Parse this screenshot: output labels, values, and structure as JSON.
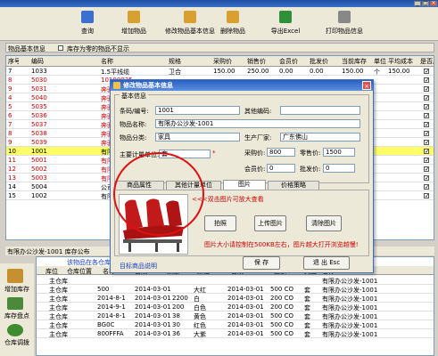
{
  "window": {
    "min": "_",
    "max": "□",
    "close": "×"
  },
  "toolbar": {
    "buttons": [
      {
        "label": "查询",
        "icon": "magnifier-icon",
        "color": "#3b6fd0"
      },
      {
        "label": "增加物品",
        "icon": "add-item-icon",
        "color": "#d8a030"
      },
      {
        "label": "修改物品基本信息",
        "icon": "edit-item-icon",
        "color": "#d8a030"
      },
      {
        "label": "删除物品",
        "icon": "delete-item-icon",
        "color": "#d8a030"
      },
      {
        "label": "导出Excel",
        "icon": "excel-icon",
        "color": "#2f8f3a"
      },
      {
        "label": "打印物品信息",
        "icon": "print-icon",
        "color": "#888888"
      }
    ]
  },
  "filter": {
    "section_label": "物品基本信息",
    "checkbox_label": "库存为零的物品不显示"
  },
  "grid": {
    "headers": [
      "序号",
      "编码",
      "名称",
      "规格",
      "采购价",
      "销售价",
      "会员价",
      "批发价",
      "当前库存",
      "单位",
      "平均成本",
      "是否启用"
    ],
    "rows": [
      {
        "no": "7",
        "code": "1033",
        "name": "1.5平线缆",
        "spec": "卫合",
        "buy": "150.00",
        "sell": "250.00",
        "member": "0.00",
        "whole": "0.00",
        "stock": "150.00",
        "unit": "个",
        "avg": "150.00",
        "red": false
      },
      {
        "no": "8",
        "code": "5030",
        "name": "10100035",
        "spec": "",
        "buy": "",
        "sell": "",
        "member": "",
        "whole": "",
        "stock": "",
        "unit": "",
        "avg": "",
        "red": true
      },
      {
        "no": "9",
        "code": "5031",
        "name": "奔驰F",
        "spec": "",
        "buy": "",
        "sell": "",
        "member": "",
        "whole": "",
        "stock": "",
        "unit": "",
        "avg": "",
        "red": true
      },
      {
        "no": "4",
        "code": "5040",
        "name": "奔驰F",
        "spec": "",
        "buy": "",
        "sell": "",
        "member": "",
        "whole": "",
        "stock": "",
        "unit": "",
        "avg": "",
        "red": true
      },
      {
        "no": "5",
        "code": "5035",
        "name": "奔驰不铁",
        "spec": "",
        "buy": "",
        "sell": "",
        "member": "",
        "whole": "",
        "stock": "",
        "unit": "",
        "avg": "",
        "red": true
      },
      {
        "no": "6",
        "code": "5036",
        "name": "奔驰B",
        "spec": "",
        "buy": "",
        "sell": "",
        "member": "",
        "whole": "",
        "stock": "",
        "unit": "",
        "avg": "",
        "red": true
      },
      {
        "no": "7",
        "code": "5037",
        "name": "奔驰C",
        "spec": "",
        "buy": "",
        "sell": "",
        "member": "",
        "whole": "",
        "stock": "",
        "unit": "",
        "avg": "",
        "red": true
      },
      {
        "no": "8",
        "code": "5038",
        "name": "奔驰D",
        "spec": "",
        "buy": "",
        "sell": "",
        "member": "",
        "whole": "",
        "stock": "",
        "unit": "",
        "avg": "",
        "red": true
      },
      {
        "no": "9",
        "code": "5039",
        "name": "奔驰E",
        "spec": "",
        "buy": "",
        "sell": "",
        "member": "",
        "whole": "",
        "stock": "",
        "unit": "",
        "avg": "",
        "red": true
      },
      {
        "no": "10",
        "code": "1001",
        "name": "有限办公",
        "spec": "",
        "buy": "",
        "sell": "",
        "member": "",
        "whole": "",
        "stock": "",
        "unit": "",
        "avg": "",
        "red": false
      },
      {
        "no": "11",
        "code": "5001",
        "name": "有限办公",
        "spec": "",
        "buy": "",
        "sell": "",
        "member": "",
        "whole": "",
        "stock": "",
        "unit": "",
        "avg": "",
        "red": true
      },
      {
        "no": "12",
        "code": "5002",
        "name": "有限办公",
        "spec": "",
        "buy": "",
        "sell": "",
        "member": "",
        "whole": "",
        "stock": "",
        "unit": "",
        "avg": "",
        "red": true
      },
      {
        "no": "13",
        "code": "5003",
        "name": "有限办公",
        "spec": "",
        "buy": "",
        "sell": "",
        "member": "",
        "whole": "",
        "stock": "",
        "unit": "",
        "avg": "",
        "red": true
      },
      {
        "no": "14",
        "code": "5004",
        "name": "公司-1001",
        "spec": "",
        "buy": "",
        "sell": "",
        "member": "",
        "whole": "",
        "stock": "",
        "unit": "",
        "avg": "",
        "red": false
      },
      {
        "no": "15",
        "code": "1002",
        "name": "有限办公",
        "spec": "",
        "buy": "",
        "sell": "",
        "member": "",
        "whole": "",
        "stock": "",
        "unit": "",
        "avg": "",
        "red": false
      }
    ],
    "selected_index": 9
  },
  "bottom": {
    "label": "有限办公沙发-1001 库存公布"
  },
  "sidebar": {
    "items": [
      {
        "label": "增加库存"
      },
      {
        "label": "库存盘点"
      },
      {
        "label": "仓库调拨"
      }
    ]
  },
  "stock_table": {
    "title": "该物品在各仓库的库存",
    "headers": [
      "",
      "库位",
      "仓库位置",
      "名称",
      "日期",
      "数量",
      "颜色",
      "日期",
      "金额",
      "类型",
      "名称"
    ],
    "rows": [
      {
        "loc": "主仓库",
        "a": "",
        "b": "",
        "d": "",
        "e": "",
        "f": "",
        "g": "",
        "h": "",
        "i": "有限办公沙发-1001"
      },
      {
        "loc": "主仓库",
        "a": "500",
        "b": "2014-03-01",
        "d": "",
        "e": "大红",
        "f": "2014-03-01",
        "g": "500 CO",
        "h": "套",
        "i": "有限办公沙发-1001"
      },
      {
        "loc": "主仓库",
        "a": "2014-8-1",
        "b": "2014-03-01",
        "d": "2200",
        "e": "白",
        "f": "2014-03-01",
        "g": "200 CO",
        "h": "套",
        "i": "有限办公沙发-1001"
      },
      {
        "loc": "主仓库",
        "a": "2014-9-1",
        "b": "2014-03-01",
        "d": "200",
        "e": "白色",
        "f": "2014-03-01",
        "g": "200 CO",
        "h": "套",
        "i": "有限办公沙发-1001"
      },
      {
        "loc": "主仓库",
        "a": "2014-8-1",
        "b": "2014-03-01",
        "d": "38",
        "e": "黄色",
        "f": "2014-03-01",
        "g": "500 CO",
        "h": "套",
        "i": "有限办公沙发-1001"
      },
      {
        "loc": "主仓库",
        "a": "BG0C",
        "b": "2014-03-01",
        "d": "30",
        "e": "红色",
        "f": "2014-03-01",
        "g": "500 CO",
        "h": "套",
        "i": "有限办公沙发-1001"
      },
      {
        "loc": "主仓库",
        "a": "800FFFA",
        "b": "2014-03-01",
        "d": "36",
        "e": "大紫",
        "f": "2014-03-01",
        "g": "500 CO",
        "h": "套",
        "i": "有限办公沙发-1001"
      }
    ]
  },
  "dialog": {
    "title": "修改物品基本信息",
    "section": "基本信息",
    "code_label": "条码/编号:",
    "code_value": "1001",
    "other_code_label": "其他编码:",
    "other_code_value": "",
    "name_label": "物品名称:",
    "name_value": "有限办公沙发-1001",
    "category_label": "物品分类:",
    "category_value": "家具",
    "maker_label": "生产厂家:",
    "maker_value": "广东佛山",
    "unit_label": "主要计量单位:",
    "unit_value": "套",
    "buy_label": "采购价:",
    "buy_value": "800",
    "sell_label": "零售价:",
    "sell_value": "1500",
    "member_label": "会员价:",
    "member_value": "0",
    "whole_label": "批发价:",
    "whole_value": "0",
    "tabs": [
      "商品属性",
      "其他计量单位",
      "图片",
      "价格策略"
    ],
    "active_tab": 2,
    "image_hint": "<<<双击图片可放大查看",
    "photo_btn": "拍照",
    "upload_btn": "上传图片",
    "clear_btn": "清除图片",
    "size_note": "图片大小请控制在500KB左右，图片越大打开浏览越慢!",
    "img_caption": "目标商品说明",
    "ok": "保 存",
    "cancel": "退 出 Esc"
  },
  "colors": {
    "accent": "#2a5fc2",
    "selected": "#ffff66",
    "red_text": "#cc0000",
    "seat": "#c21a1a"
  }
}
